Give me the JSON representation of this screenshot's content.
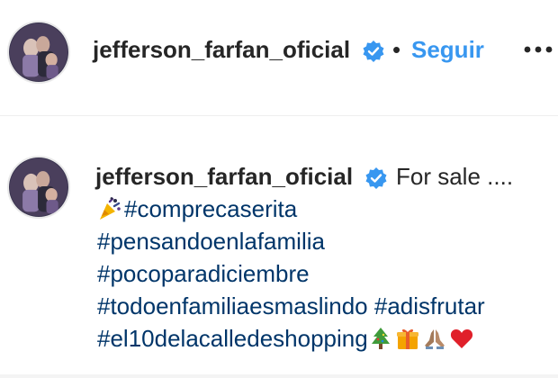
{
  "post": {
    "header": {
      "username": "jefferson_farfan_oficial",
      "separator": "•",
      "follow_label": "Seguir",
      "avatar_icon": "profile-photo",
      "verified_icon": "verified-badge-icon",
      "more_icon": "more-options-icon"
    },
    "caption": {
      "username": "jefferson_farfan_oficial",
      "text": "For sale ....",
      "lines": [
        {
          "emoji_before": "party-popper-icon",
          "tags": [
            "#comprecaserita"
          ]
        },
        {
          "tags": [
            "#pensandoenlafamilia"
          ]
        },
        {
          "tags": [
            "#pocoparadiciembre"
          ]
        },
        {
          "tags": [
            "#todoenfamiliaesmaslindo",
            "#adisfrutar"
          ]
        },
        {
          "tags": [
            "#el10delacalledeshopping"
          ],
          "emoji_after": [
            "christmas-tree-icon",
            "gift-icon",
            "folded-hands-icon",
            "red-heart-icon"
          ]
        }
      ]
    },
    "colors": {
      "link_blue": "#3897f0",
      "hashtag_blue": "#003569",
      "text_dark": "#262626",
      "verified_blue": "#3897f0",
      "divider": "#efefef"
    }
  }
}
